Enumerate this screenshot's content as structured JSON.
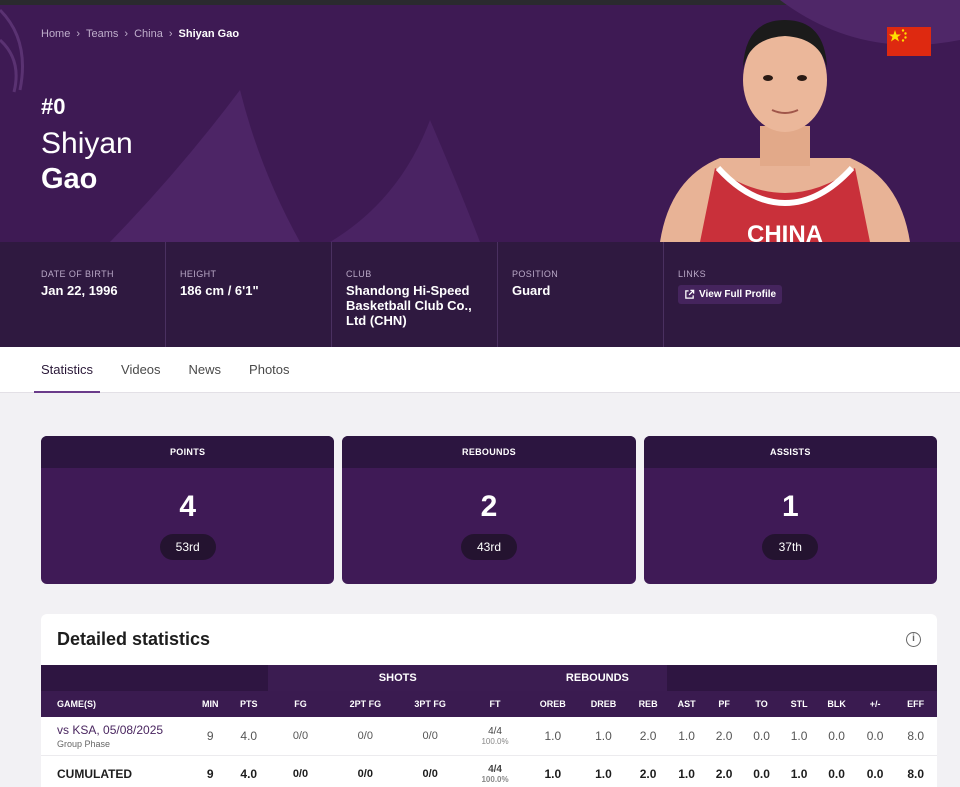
{
  "breadcrumb": [
    "Home",
    "Teams",
    "China",
    "Shiyan Gao"
  ],
  "player": {
    "number": "#0",
    "first_name": "Shiyan",
    "last_name": "Gao"
  },
  "info": [
    {
      "label": "DATE OF BIRTH",
      "value": "Jan 22, 1996"
    },
    {
      "label": "HEIGHT",
      "value": "186 cm / 6'1\""
    },
    {
      "label": "CLUB",
      "value": "Shandong Hi-Speed Basketball Club Co., Ltd (CHN)"
    },
    {
      "label": "POSITION",
      "value": "Guard"
    },
    {
      "label": "LINKS",
      "link_label": "View Full Profile"
    }
  ],
  "tabs": [
    "Statistics",
    "Videos",
    "News",
    "Photos"
  ],
  "cards": [
    {
      "title": "POINTS",
      "value": "4",
      "rank": "53rd"
    },
    {
      "title": "REBOUNDS",
      "value": "2",
      "rank": "43rd"
    },
    {
      "title": "ASSISTS",
      "value": "1",
      "rank": "37th"
    }
  ],
  "detailed": {
    "title": "Detailed statistics",
    "groups": {
      "shots": "SHOTS",
      "rebounds": "REBOUNDS"
    },
    "columns": [
      "GAME(S)",
      "MIN",
      "PTS",
      "FG",
      "2PT FG",
      "3PT FG",
      "FT",
      "OREB",
      "DREB",
      "REB",
      "AST",
      "PF",
      "TO",
      "STL",
      "BLK",
      "+/-",
      "EFF"
    ],
    "rows": [
      {
        "game": "vs KSA, 05/08/2025",
        "phase": "Group Phase",
        "min": "9",
        "pts": "4.0",
        "fg": "0/0",
        "fg2": "0/0",
        "fg3": "0/0",
        "ft": "4/4",
        "ft_pct": "100.0%",
        "oreb": "1.0",
        "dreb": "1.0",
        "reb": "2.0",
        "ast": "1.0",
        "pf": "2.0",
        "to": "0.0",
        "stl": "1.0",
        "blk": "0.0",
        "pm": "0.0",
        "eff": "8.0"
      },
      {
        "game": "CUMULATED",
        "min": "9",
        "pts": "4.0",
        "fg": "0/0",
        "fg2": "0/0",
        "fg3": "0/0",
        "ft": "4/4",
        "ft_pct": "100.0%",
        "oreb": "1.0",
        "dreb": "1.0",
        "reb": "2.0",
        "ast": "1.0",
        "pf": "2.0",
        "to": "0.0",
        "stl": "1.0",
        "blk": "0.0",
        "pm": "0.0",
        "eff": "8.0"
      }
    ]
  },
  "colors": {
    "hero": "#3e1a54",
    "infobar": "#2f1940",
    "card": "#3f1a56",
    "flag_red": "#de2910",
    "flag_star": "#ffde00"
  }
}
